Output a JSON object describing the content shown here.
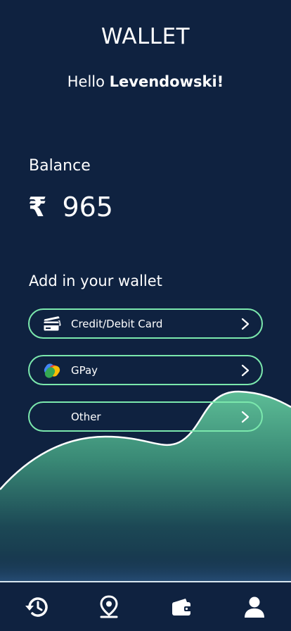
{
  "header": {
    "title": "WALLET",
    "greeting_prefix": "Hello ",
    "user_name": "Levendowski!"
  },
  "balance": {
    "label": "Balance",
    "currency_symbol": "₹",
    "amount": "965"
  },
  "add_section": {
    "heading": "Add in your wallet",
    "options": [
      {
        "label": "Credit/Debit Card",
        "icon": "credit-card-icon"
      },
      {
        "label": "GPay",
        "icon": "gpay-icon"
      },
      {
        "label": "Other",
        "icon": ""
      }
    ]
  },
  "tabbar": {
    "items": [
      {
        "icon": "history-icon"
      },
      {
        "icon": "location-pin-icon"
      },
      {
        "icon": "wallet-icon"
      },
      {
        "icon": "profile-icon"
      }
    ]
  },
  "colors": {
    "background": "#0f2240",
    "accent_border": "#7be8ad",
    "wave_top": "#58b590",
    "text": "#ffffff"
  }
}
